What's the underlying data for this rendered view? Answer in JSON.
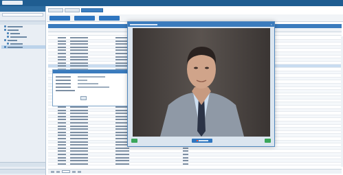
{
  "app": {
    "brand": "",
    "top_right": ""
  },
  "sidebar": {
    "header": "",
    "items": [
      {
        "label": "",
        "selected": false
      },
      {
        "label": "",
        "selected": false
      },
      {
        "label": "",
        "selected": false
      },
      {
        "label": "",
        "selected": false
      },
      {
        "label": "",
        "selected": false
      },
      {
        "label": "",
        "selected": false
      },
      {
        "label": "",
        "selected": true
      }
    ],
    "footer_1": "",
    "footer_2": ""
  },
  "main": {
    "tabs": [
      "",
      "",
      ""
    ],
    "toolbar": [
      "",
      "",
      ""
    ],
    "grid_title": "",
    "columns": [
      "",
      "",
      "",
      "",
      ""
    ]
  },
  "modal": {
    "title": "",
    "close": "×",
    "center_button": ""
  },
  "colors": {
    "brand": "#1f5d91",
    "accent": "#3a7bbd",
    "button": "#2f76c0",
    "confirm": "#3aa65a"
  },
  "icons": [
    "close-icon",
    "tree-node-icon",
    "user-photo"
  ]
}
